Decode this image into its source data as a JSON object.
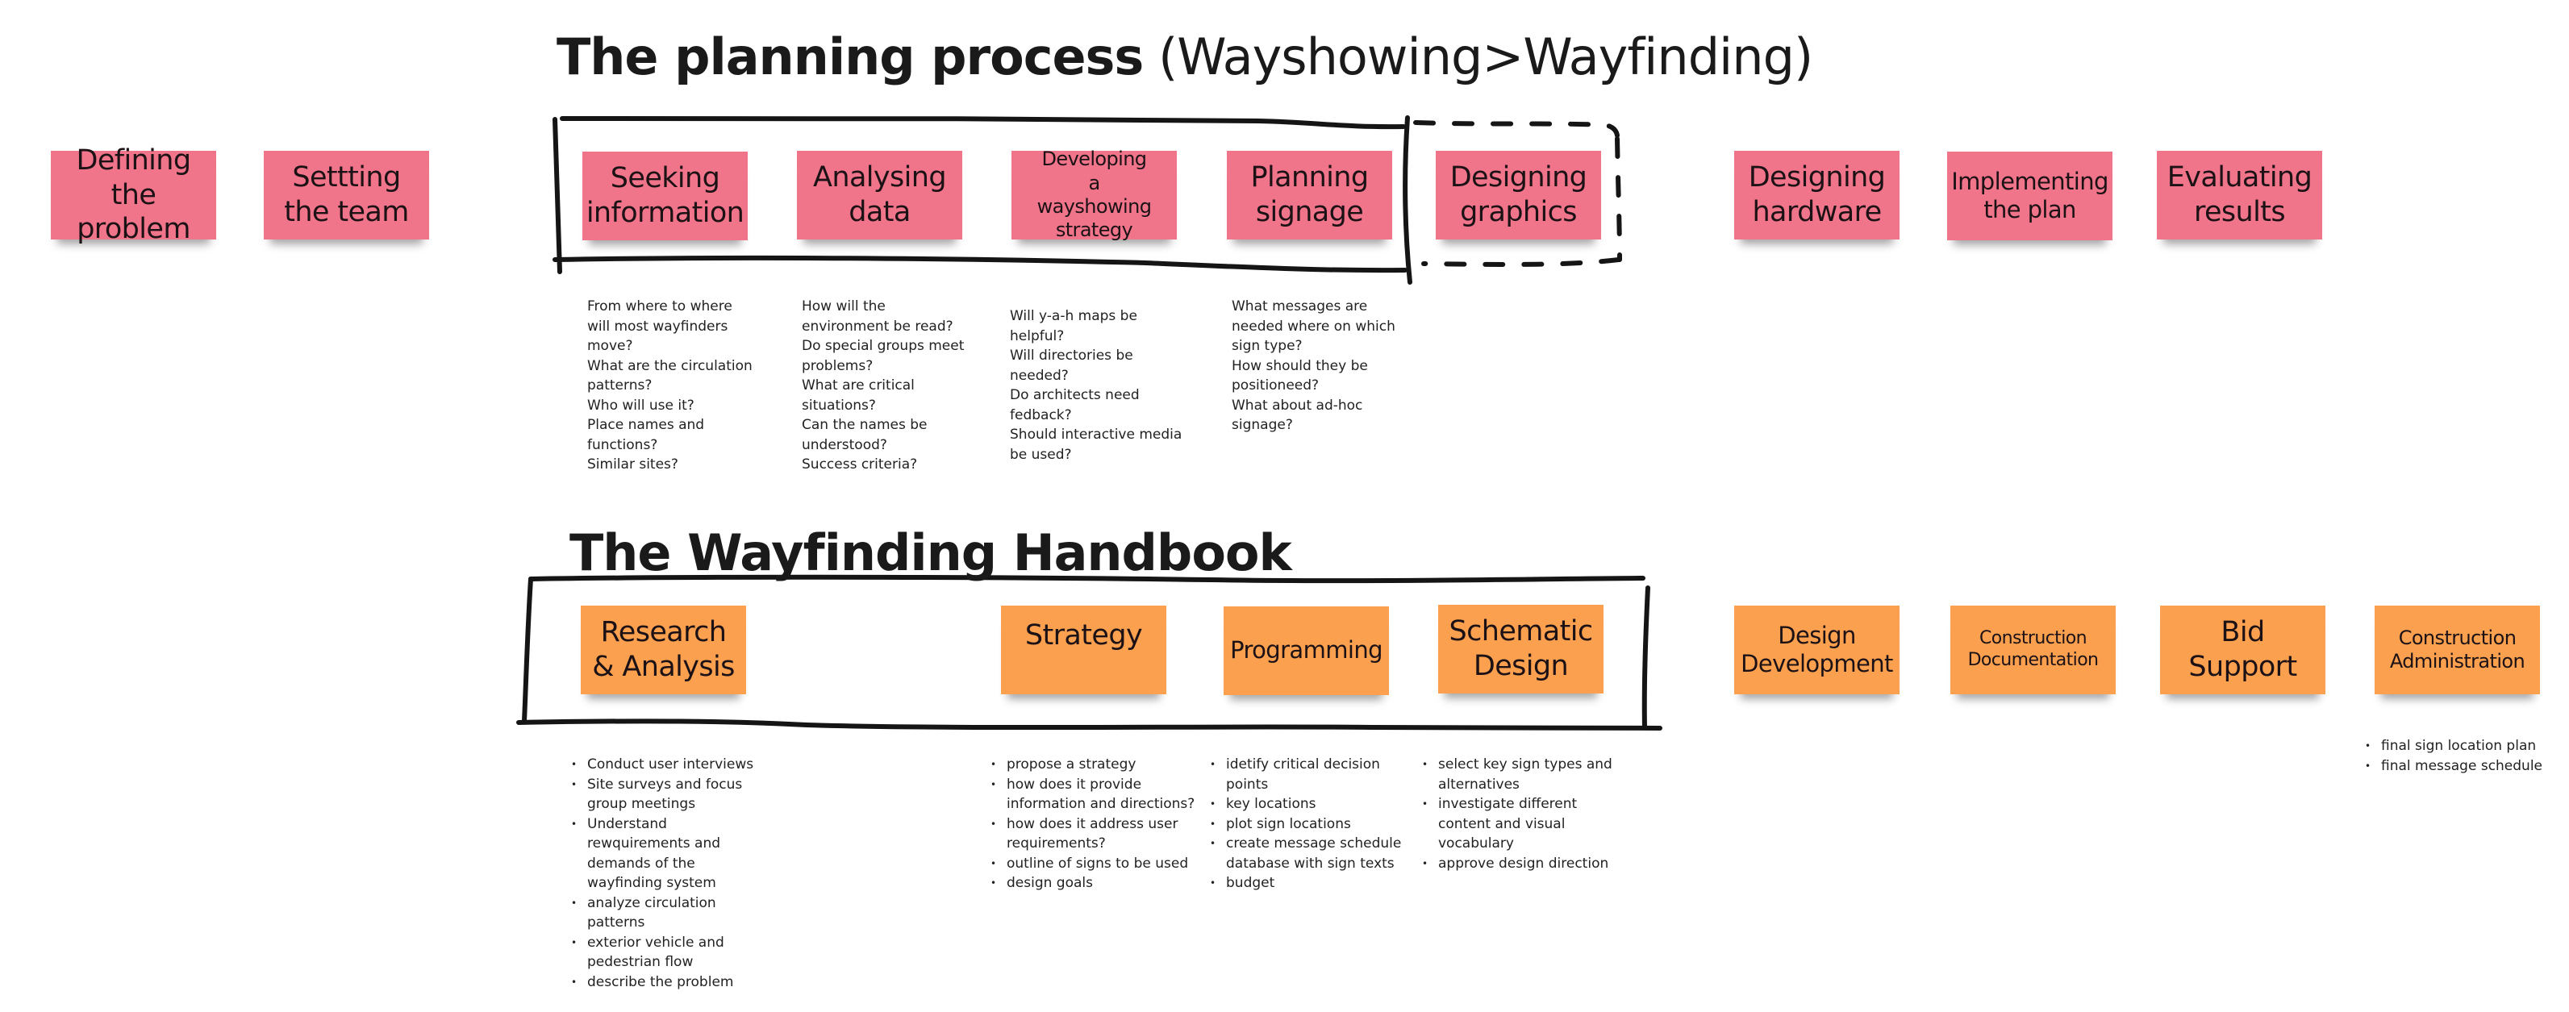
{
  "section1": {
    "title_bold": "The planning process",
    "title_regular": "(Wayshowing>Wayfinding)",
    "notes": [
      {
        "label": "Defining the problem"
      },
      {
        "label": "Settting the team"
      },
      {
        "label": "Seeking information"
      },
      {
        "label": "Analysing data"
      },
      {
        "label": "Developing a wayshowing strategy"
      },
      {
        "label": "Planning signage"
      },
      {
        "label": "Designing graphics"
      },
      {
        "label": "Designing hardware"
      },
      {
        "label": "Implementing the plan"
      },
      {
        "label": "Evaluating results"
      }
    ],
    "questions": [
      {
        "for": "Seeking information",
        "lines": [
          "From where to where will most wayfinders move?",
          "What are the circulation patterns?",
          "Who will use it?",
          "Place names and functions?",
          "Similar sites?"
        ]
      },
      {
        "for": "Analysing data",
        "lines": [
          "How will the environment be read?",
          "Do special groups meet problems?",
          "What are critical situations?",
          "Can the names be understood?",
          "Success criteria?"
        ]
      },
      {
        "for": "Developing a wayshowing strategy",
        "lines": [
          "Will y-a-h maps be helpful?",
          "Will directories be needed?",
          "Do architects need fedback?",
          "Should interactive media be used?"
        ]
      },
      {
        "for": "Planning signage",
        "lines": [
          "What messages are needed where on which sign type?",
          "How should they be positioneed?",
          "What about ad-hoc signage?"
        ]
      }
    ]
  },
  "section2": {
    "title": "The Wayfinding Handbook",
    "notes": [
      {
        "label": "Research & Analysis"
      },
      {
        "label": "Strategy"
      },
      {
        "label": "Programming"
      },
      {
        "label": "Schematic Design"
      },
      {
        "label": "Design Development"
      },
      {
        "label": "Construction Documentation"
      },
      {
        "label": "Bid Support"
      },
      {
        "label": "Construction Administration"
      }
    ],
    "bullets": [
      {
        "for": "Research & Analysis",
        "items": [
          "Conduct user interviews",
          "Site surveys and focus group meetings",
          "Understand rewquirements and demands of the wayfinding system",
          "analyze circulation patterns",
          "exterior vehicle and pedestrian flow",
          "describe the problem"
        ]
      },
      {
        "for": "Strategy",
        "items": [
          "propose a strategy",
          "how does it provide information and directions?",
          "how does it address user requirements?",
          "outline of signs to be used",
          "design goals"
        ]
      },
      {
        "for": "Programming",
        "items": [
          "idetify critical decision points",
          "key locations",
          "plot sign locations",
          "create message schedule database with sign texts",
          "budget"
        ]
      },
      {
        "for": "Schematic Design",
        "items": [
          "select key sign types and alternatives",
          "investigate different content and visual vocabulary",
          "approve design direction"
        ]
      },
      {
        "for": "Construction Administration",
        "items": [
          "final sign location plan",
          "final message schedule"
        ]
      }
    ]
  },
  "colors": {
    "pink_note": "#f0758a",
    "orange_note": "#fba04f",
    "ink": "#1a1a1a"
  }
}
